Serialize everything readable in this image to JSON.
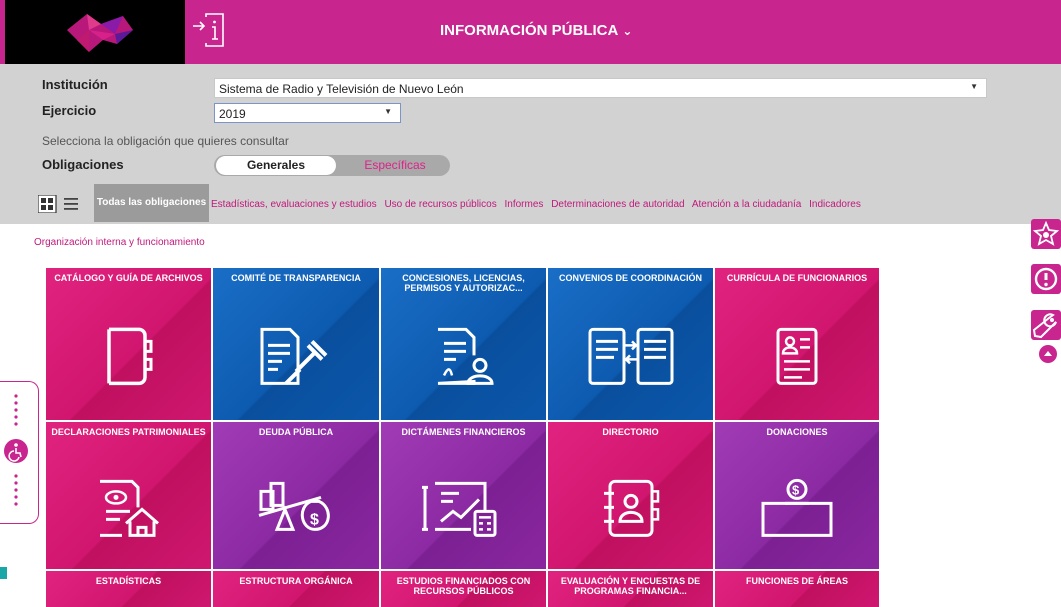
{
  "header": {
    "title": "INFORMACIÓN PÚBLICA",
    "brand_color": "#c8258e"
  },
  "filters": {
    "institution_label": "Institución",
    "institution_value": "Sistema de Radio y Televisión de Nuevo León",
    "year_label": "Ejercicio",
    "year_value": "2019",
    "hint": "Selecciona la obligación que quieres consultar",
    "obligations_label": "Obligaciones",
    "toggle_general": "Generales",
    "toggle_specific": "Específicas"
  },
  "categories": {
    "active": "Todas las obligaciones",
    "items": [
      "Estadísticas, evaluaciones y estudios",
      "Uso de recursos públicos",
      "Informes",
      "Determinaciones de autoridad",
      "Atención a la ciudadanía",
      "Indicadores"
    ],
    "second_row": "Organización interna y funcionamiento"
  },
  "tiles": [
    {
      "title": "CATÁLOGO Y GUÍA DE ARCHIVOS",
      "color": "pink",
      "icon": "binder-icon"
    },
    {
      "title": "COMITÉ DE TRANSPARENCIA",
      "color": "blue",
      "icon": "document-gavel-icon"
    },
    {
      "title": "CONCESIONES, LICENCIAS, PERMISOS Y AUTORIZAC...",
      "color": "blue",
      "icon": "document-person-icon"
    },
    {
      "title": "CONVENIOS DE COORDINACIÓN",
      "color": "blue",
      "icon": "documents-exchange-icon"
    },
    {
      "title": "CURRÍCULA DE FUNCIONARIOS",
      "color": "pink",
      "icon": "resume-icon"
    },
    {
      "title": "DECLARACIONES PATRIMONIALES",
      "color": "pink",
      "icon": "document-house-icon"
    },
    {
      "title": "DEUDA PÚBLICA",
      "color": "purple",
      "icon": "balance-money-icon"
    },
    {
      "title": "DICTÁMENES FINANCIEROS",
      "color": "purple",
      "icon": "chart-calculator-icon"
    },
    {
      "title": "DIRECTORIO",
      "color": "pink",
      "icon": "address-book-icon"
    },
    {
      "title": "DONACIONES",
      "color": "purple",
      "icon": "donation-box-icon"
    },
    {
      "title": "ESTADÍSTICAS",
      "color": "pink",
      "icon": ""
    },
    {
      "title": "ESTRUCTURA ORGÁNICA",
      "color": "pink",
      "icon": ""
    },
    {
      "title": "ESTUDIOS FINANCIADOS CON RECURSOS PÚBLICOS",
      "color": "pink",
      "icon": ""
    },
    {
      "title": "EVALUACIÓN Y ENCUESTAS DE PROGRAMAS FINANCIA...",
      "color": "pink",
      "icon": ""
    },
    {
      "title": "FUNCIONES DE ÁREAS",
      "color": "pink",
      "icon": ""
    }
  ]
}
